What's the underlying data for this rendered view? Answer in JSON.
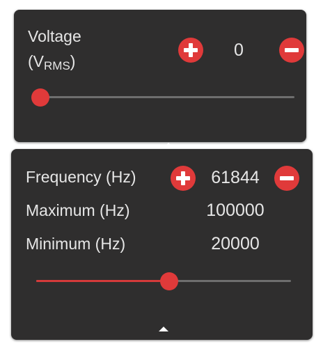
{
  "voltage": {
    "label_line1": "Voltage",
    "label_line2_prefix": "(V",
    "label_subscript": "RMS",
    "label_line2_suffix": ")",
    "value": "0",
    "slider_fraction": 0.0
  },
  "frequency": {
    "label": "Frequency (Hz)",
    "value": "61844",
    "maximum_label": "Maximum (Hz)",
    "maximum_value": "100000",
    "minimum_label": "Minimum (Hz)",
    "minimum_value": "20000",
    "slider_fraction": 0.523
  },
  "icons": {
    "increment": "plus-circle-icon",
    "decrement": "minus-circle-icon",
    "collapse": "caret-up-icon"
  },
  "colors": {
    "accent": "#e03a3a",
    "panel_background": "#2f2e2e",
    "text": "#e6e6e6",
    "track": "#6e6e6e"
  }
}
